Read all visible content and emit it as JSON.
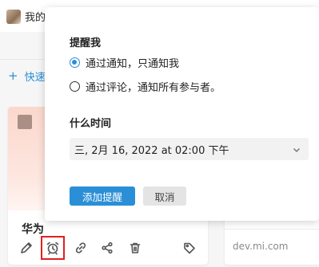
{
  "background": {
    "user_label": "我的",
    "quick_label": "快速",
    "card_title": "华为",
    "card_domain": "dev.mi.com"
  },
  "popup": {
    "remind_heading": "提醒我",
    "options": [
      {
        "label": "通过通知，只通知我",
        "checked": true
      },
      {
        "label": "通过评论，通知所有参与者。",
        "checked": false
      }
    ],
    "time_heading": "什么时间",
    "date_value": "三, 2月 16, 2022 at 02:00 下午",
    "add_button": "添加提醒",
    "cancel_button": "取消"
  },
  "toolbar": {
    "icons": [
      "edit-icon",
      "alarm-clock-icon",
      "link-icon",
      "share-icon",
      "trash-icon",
      "tag-icon"
    ]
  },
  "colors": {
    "accent": "#2a8fd6",
    "highlight_box": "#e02020",
    "card_thumb": "#fbd7cc"
  }
}
